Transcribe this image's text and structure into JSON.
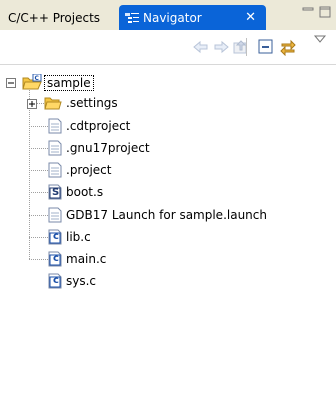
{
  "tabs": [
    {
      "label": "C/C++ Projects",
      "active": false
    },
    {
      "label": "Navigator",
      "active": true,
      "close": "✕"
    }
  ],
  "toolbar": {
    "buttons": [
      "back-arrow-icon",
      "forward-arrow-icon",
      "up-folder-icon",
      "collapse-all-icon",
      "link-with-editor-icon",
      "view-menu-icon"
    ]
  },
  "tree": {
    "root": {
      "label": "sample",
      "expanded": true,
      "icon": "project-folder-icon"
    },
    "items": [
      {
        "label": ".settings",
        "icon": "folder-icon",
        "expandable": true
      },
      {
        "label": ".cdtproject",
        "icon": "file-icon"
      },
      {
        "label": ".gnu17project",
        "icon": "file-icon"
      },
      {
        "label": ".project",
        "icon": "file-icon"
      },
      {
        "label": "boot.s",
        "icon": "asm-file-icon",
        "badge": "S"
      },
      {
        "label": "GDB17 Launch for sample.launch",
        "icon": "file-icon"
      },
      {
        "label": "lib.c",
        "icon": "c-file-icon",
        "badge": "c"
      },
      {
        "label": "main.c",
        "icon": "c-file-icon",
        "badge": "c"
      },
      {
        "label": "sys.c",
        "icon": "c-file-icon",
        "badge": "c"
      }
    ]
  },
  "colors": {
    "active_tab": "#0a64d8",
    "tab_bar": "#ece9d8",
    "folder": "#f4c542",
    "arrow_disabled": "#b8c4d8"
  }
}
